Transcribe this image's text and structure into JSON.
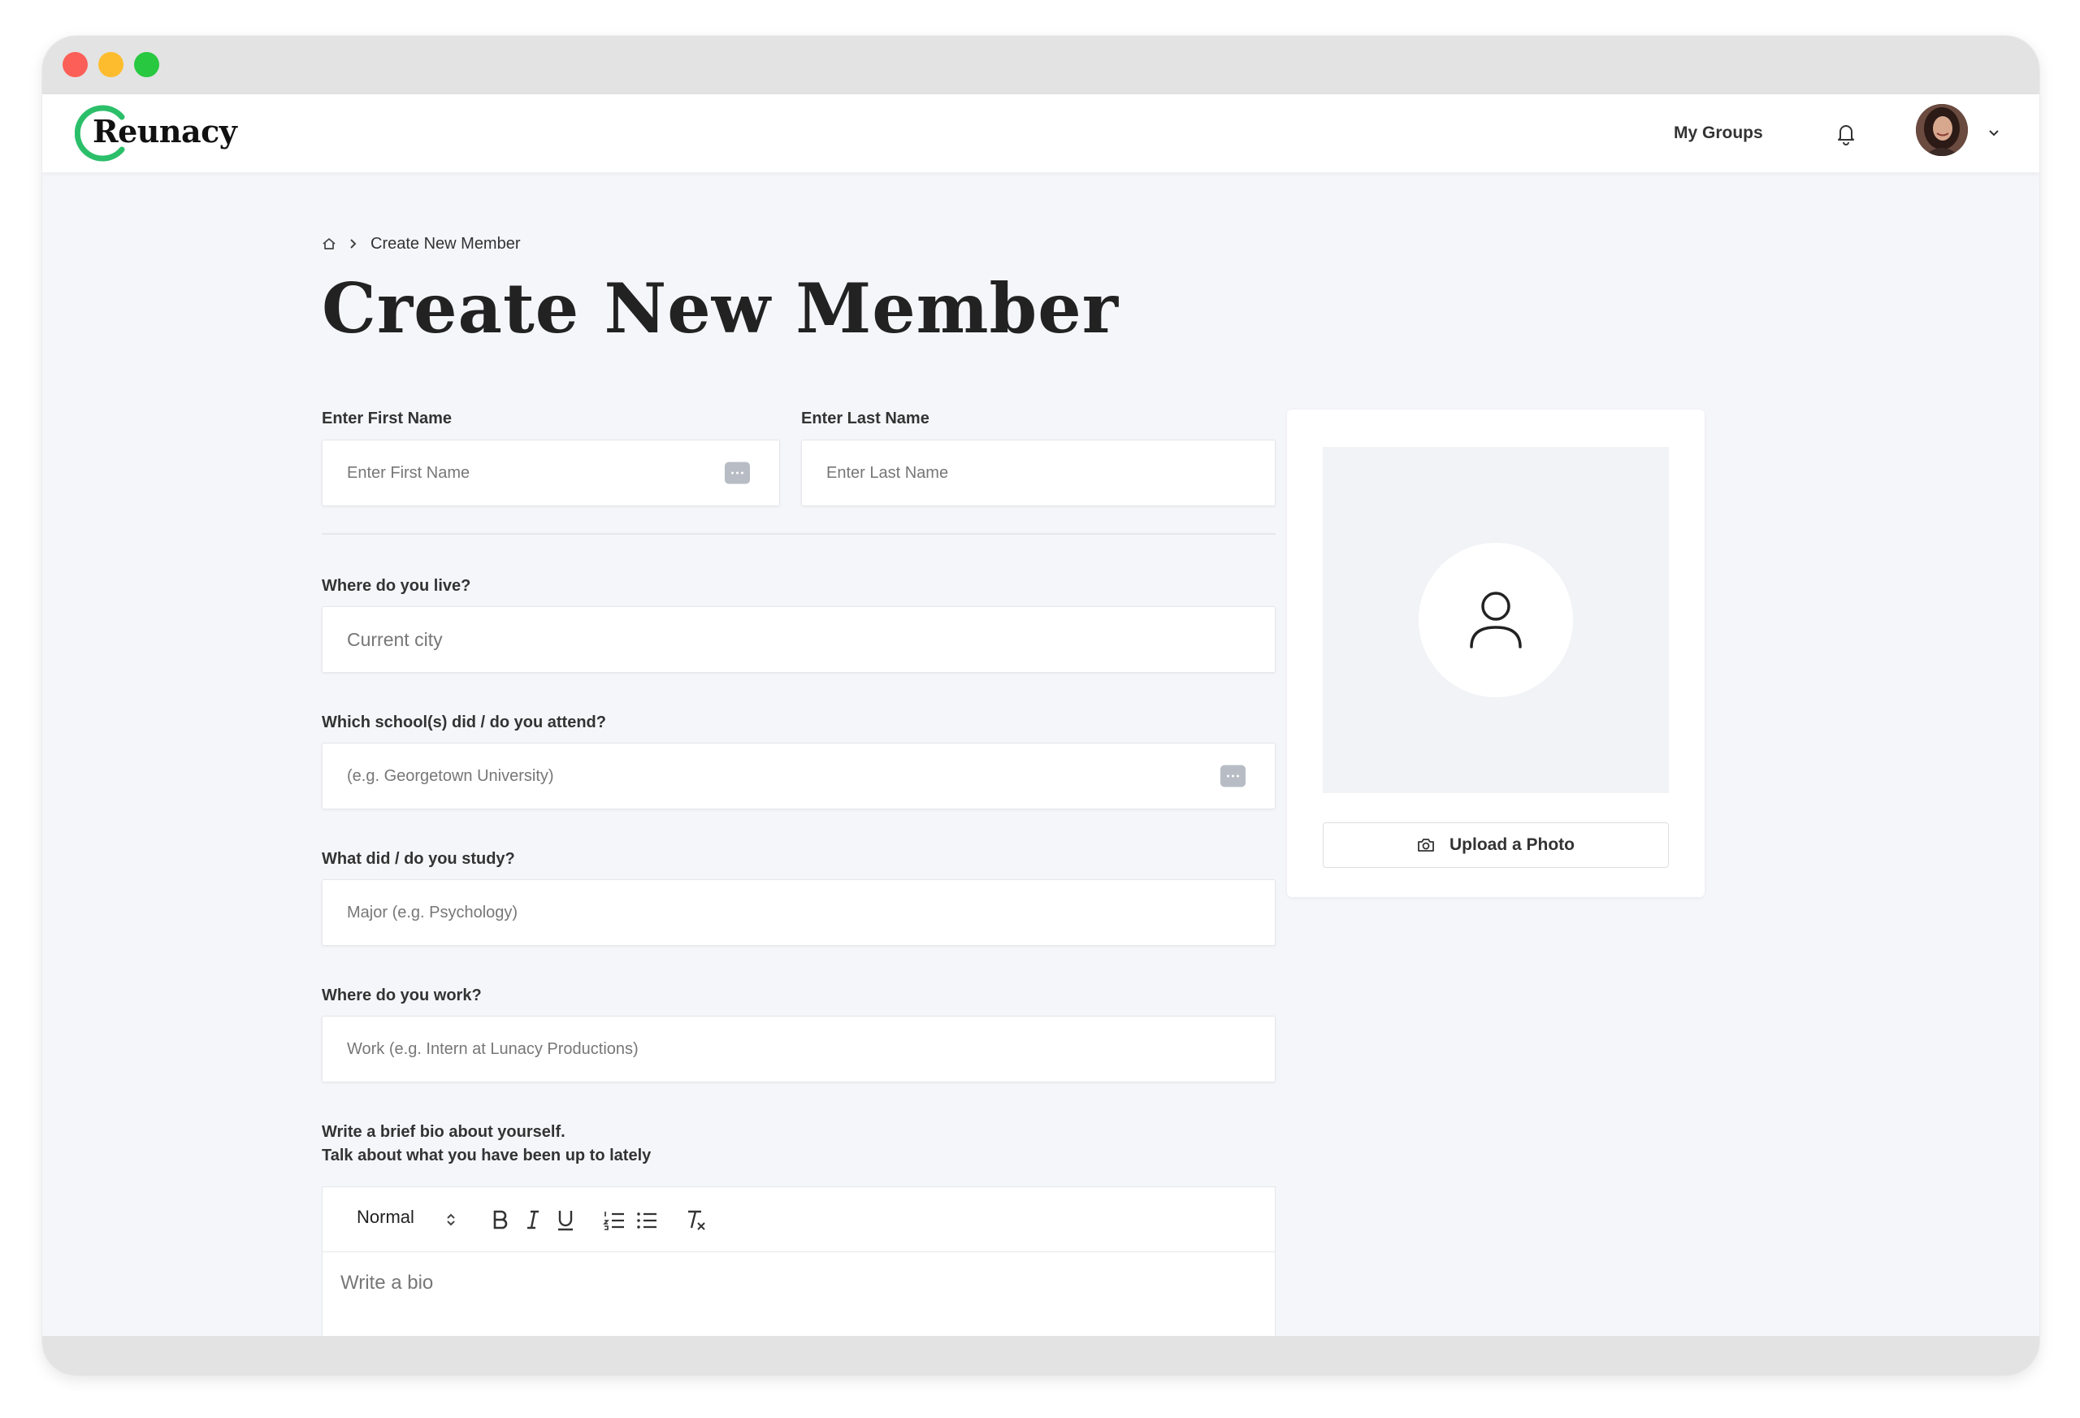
{
  "window": {
    "traffic_lights": [
      "close",
      "minimize",
      "maximize"
    ]
  },
  "nav": {
    "logo_text": "Reunacy",
    "my_groups": "My Groups",
    "icons": [
      "bell-icon",
      "avatar",
      "chevron-down-icon"
    ]
  },
  "breadcrumb": {
    "home_icon": "home-icon",
    "separator_icon": "chevron-right-icon",
    "current": "Create New Member"
  },
  "page": {
    "title": "Create New Member"
  },
  "form": {
    "first_name": {
      "label": "Enter First Name",
      "placeholder": "Enter First Name",
      "value": ""
    },
    "last_name": {
      "label": "Enter Last Name",
      "placeholder": "Enter Last Name",
      "value": ""
    },
    "city": {
      "label": "Where do you live?",
      "placeholder": "Current city",
      "value": ""
    },
    "school": {
      "label": "Which school(s) did / do you attend?",
      "placeholder": "(e.g. Georgetown University)",
      "value": ""
    },
    "study": {
      "label": "What did / do you study?",
      "placeholder": "Major (e.g. Psychology)",
      "value": ""
    },
    "work": {
      "label": "Where do you work?",
      "placeholder": "Work (e.g. Intern at Lunacy Productions)",
      "value": ""
    },
    "bio": {
      "label_line1": "Write a brief bio about yourself.",
      "label_line2": "Talk about what you have been up to lately",
      "placeholder": "Write a bio",
      "format_select": "Normal",
      "toolbar": [
        "bold-icon",
        "italic-icon",
        "underline-icon",
        "ordered-list-icon",
        "bullet-list-icon",
        "clear-format-icon"
      ]
    }
  },
  "photo": {
    "placeholder_icon": "user-icon",
    "upload_label": "Upload a Photo",
    "upload_icon": "camera-icon"
  },
  "colors": {
    "brand_green": "#2bbf6a",
    "background": "#f5f6fa"
  }
}
